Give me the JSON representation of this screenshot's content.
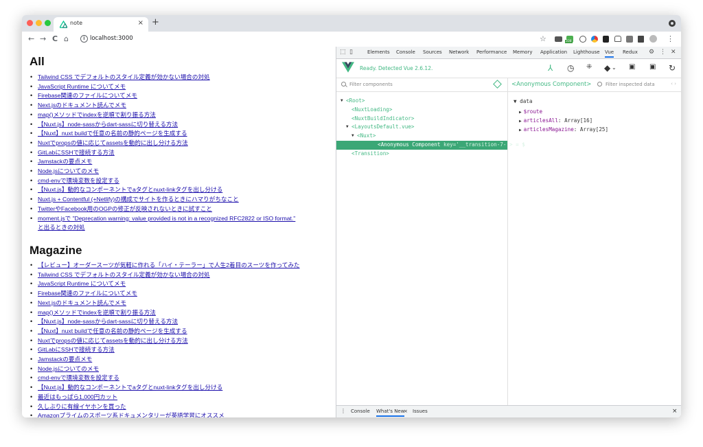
{
  "browser": {
    "tab_title": "note",
    "tab_close": "×",
    "new_tab": "+",
    "url": "localhost:3000",
    "nav_back": "←",
    "nav_forward": "→",
    "nav_reload": "C",
    "nav_home": "⌂",
    "info": "i",
    "star": "☆",
    "badge": "338",
    "kebab": "⋮"
  },
  "page": {
    "heading_all": "All",
    "heading_magazine": "Magazine",
    "all_items": [
      "Tailwind CSS でデフォルトのスタイル定義が効かない場合の対処",
      "JavaScript Runtime についてメモ",
      "Firebase関連のファイルについてメモ",
      "Next.jsのドキュメント読んでメモ",
      "map()メソッドでindexを逆順で割り振る方法",
      "【Nuxt.js】node-sassからdart-sassに切り替える方法",
      "【Nuxt】nuxt buildで任意の名前の静的ページを生成する",
      "Nuxtでpropsの値に応じてassetsを動的に出し分ける方法",
      "GitLabにSSHで接続する方法",
      "Jamstackの要点メモ",
      "Node.jsについてのメモ",
      "cmd-envで環境変数を設定する",
      "【Nuxt.js】動的なコンポーネントでaタグとnuxt-linkタグを出し分ける",
      "Nuxt.js + Contentful (+Netlify)の構成でサイトを作るときにハマりがちなこと",
      "TwitterやFacebook用のOGPの修正が反映されないときに試すこと",
      "moment.jsで \"Deprecation warning: value provided is not in a recognized RFC2822 or ISO format.\""
    ],
    "all_item_tail": "と出るときの対処",
    "magazine_items": [
      "【レビュー】オーダースーツが気軽に作れる「ハイ・テーラー」で人生2着目のスーツを作ってみた",
      "Tailwind CSS でデフォルトのスタイル定義が効かない場合の対処",
      "JavaScript Runtime についてメモ",
      "Firebase関連のファイルについてメモ",
      "Next.jsのドキュメント読んでメモ",
      "map()メソッドでindexを逆順で割り振る方法",
      "【Nuxt.js】node-sassからdart-sassに切り替える方法",
      "【Nuxt】nuxt buildで任意の名前の静的ページを生成する",
      "Nuxtでpropsの値に応じてassetsを動的に出し分ける方法",
      "GitLabにSSHで接続する方法",
      "Jamstackの要点メモ",
      "Node.jsについてのメモ",
      "cmd-envで環境変数を設定する",
      "【Nuxt.js】動的なコンポーネントでaタグとnuxt-linkタグを出し分ける",
      "最近はもっぱら1,000円カット",
      "久しぶりに有線イヤホンを買った",
      "Amazonプライムのスポーツ系ドキュメンタリーが英語学習にオススメ"
    ]
  },
  "devtools": {
    "tabs": [
      "Elements",
      "Console",
      "Sources",
      "Network",
      "Performance",
      "Memory",
      "Application",
      "Lighthouse",
      "Vue",
      "Redux"
    ],
    "active_tab": "Vue",
    "ready_text": "Ready. Detected Vue 2.6.12.",
    "filter_components_placeholder": "Filter components",
    "inspected_title": "<Anonymous Component>",
    "filter_inspected_placeholder": "Filter inspected data",
    "tree": [
      {
        "label": "<Root>",
        "depth": 0,
        "arrow": "▼"
      },
      {
        "label": "<NuxtLoading>",
        "depth": 1,
        "arrow": ""
      },
      {
        "label": "<NuxtBuildIndicator>",
        "depth": 1,
        "arrow": ""
      },
      {
        "label": "<LayoutsDefault.vue>",
        "depth": 1,
        "arrow": "▼"
      },
      {
        "label": "<Nuxt>",
        "depth": 2,
        "arrow": "▼"
      },
      {
        "label": "<Anonymous Component",
        "depth": 3,
        "arrow": "",
        "selected": true,
        "key": "key='__transition-7-'> = $"
      },
      {
        "label": "<Transition>",
        "depth": 1,
        "arrow": ""
      }
    ],
    "data_section": "data",
    "data_rows": [
      {
        "key": "$route",
        "value": ""
      },
      {
        "key": "articlesAll",
        "value": ": Array[16]"
      },
      {
        "key": "articlesMagazine",
        "value": ": Array[25]"
      }
    ],
    "drawer_tabs": [
      "Console",
      "What's New",
      "Issues"
    ],
    "drawer_close": "×",
    "drawer_tab_close": "×"
  }
}
